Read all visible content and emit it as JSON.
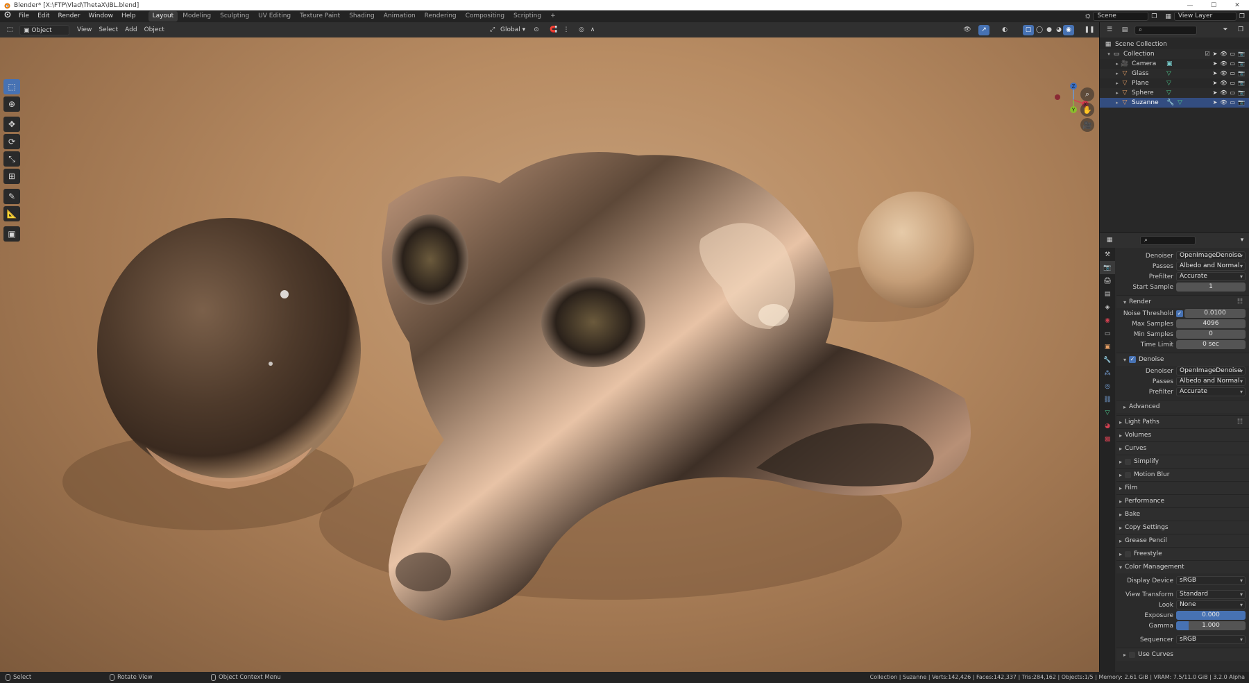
{
  "window": {
    "title": "Blender* [X:\\FTP\\Vlad\\ThetaX\\IBL.blend]",
    "minimize": "—",
    "maximize": "☐",
    "close": "✕"
  },
  "menu": {
    "items": [
      "File",
      "Edit",
      "Render",
      "Window",
      "Help"
    ],
    "workspaces": [
      "Layout",
      "Modeling",
      "Sculpting",
      "UV Editing",
      "Texture Paint",
      "Shading",
      "Animation",
      "Rendering",
      "Compositing",
      "Scripting"
    ],
    "active_workspace": "Layout",
    "add_workspace": "+",
    "scene": "Scene",
    "view_layer": "View Layer"
  },
  "viewport_header": {
    "mode": "Object Mode",
    "menus": [
      "View",
      "Select",
      "Add",
      "Object"
    ],
    "orientation": "Global"
  },
  "toolbar": {
    "tools": [
      "select-box",
      "cursor",
      "move",
      "rotate",
      "scale",
      "transform",
      "annotate",
      "measure",
      "add-cube"
    ]
  },
  "gizmo": {
    "z": "Z",
    "x": "X",
    "y": "Y"
  },
  "outliner": {
    "root": "Scene Collection",
    "collection": "Collection",
    "objects": [
      {
        "name": "Camera",
        "type": "camera"
      },
      {
        "name": "Glass",
        "type": "mesh"
      },
      {
        "name": "Plane",
        "type": "mesh"
      },
      {
        "name": "Sphere",
        "type": "mesh"
      },
      {
        "name": "Suzanne",
        "type": "mesh",
        "selected": true
      }
    ]
  },
  "properties": {
    "top": {
      "denoiser_label": "Denoiser",
      "denoiser": "OpenImageDenoise",
      "passes_label": "Passes",
      "passes": "Albedo and Normal",
      "prefilter_label": "Prefilter",
      "prefilter": "Accurate",
      "start_sample_label": "Start Sample",
      "start_sample": "1"
    },
    "render": {
      "title": "Render",
      "noise_threshold_label": "Noise Threshold",
      "noise_threshold": "0.0100",
      "max_samples_label": "Max Samples",
      "max_samples": "4096",
      "min_samples_label": "Min Samples",
      "min_samples": "0",
      "time_limit_label": "Time Limit",
      "time_limit": "0 sec"
    },
    "denoise": {
      "title": "Denoise",
      "denoiser_label": "Denoiser",
      "denoiser": "OpenImageDenoise",
      "passes_label": "Passes",
      "passes": "Albedo and Normal",
      "prefilter_label": "Prefilter",
      "prefilter": "Accurate"
    },
    "advanced": "Advanced",
    "sections": [
      "Light Paths",
      "Volumes",
      "Curves",
      "Simplify",
      "Motion Blur",
      "Film",
      "Performance",
      "Bake",
      "Copy Settings",
      "Grease Pencil",
      "Freestyle"
    ],
    "color_management": {
      "title": "Color Management",
      "display_device_label": "Display Device",
      "display_device": "sRGB",
      "view_transform_label": "View Transform",
      "view_transform": "Standard",
      "look_label": "Look",
      "look": "None",
      "exposure_label": "Exposure",
      "exposure": "0.000",
      "gamma_label": "Gamma",
      "gamma": "1.000",
      "sequencer_label": "Sequencer",
      "sequencer": "sRGB",
      "use_curves": "Use Curves"
    }
  },
  "statusbar": {
    "select": "Select",
    "rotate": "Rotate View",
    "context": "Object Context Menu",
    "stats": "Collection | Suzanne | Verts:142,426 | Faces:142,337 | Tris:284,162 | Objects:1/5 | Memory: 2.61 GiB | VRAM: 7.5/11.0 GiB | 3.2.0 Alpha"
  },
  "colors": {
    "accent": "#4772b3",
    "selection": "#334d80",
    "panel": "#2b2b2b",
    "header": "#303030"
  }
}
